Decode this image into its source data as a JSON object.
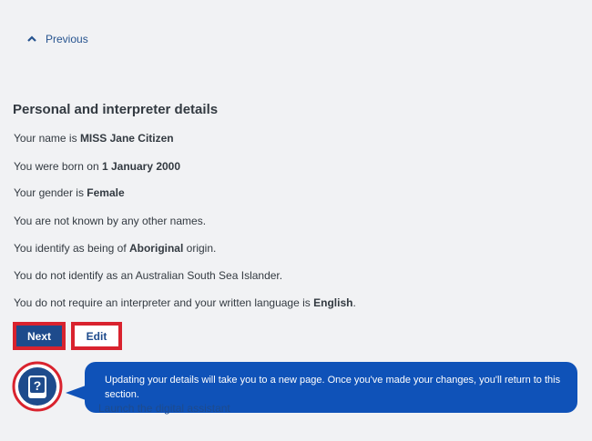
{
  "nav": {
    "previous_label": "Previous"
  },
  "section": {
    "heading": "Personal and interpreter details",
    "name": {
      "prefix": "Your name is ",
      "value": "MISS Jane Citizen"
    },
    "dob": {
      "prefix": "You were born on ",
      "value": "1 January 2000"
    },
    "gender": {
      "prefix": "Your gender is ",
      "value": "Female"
    },
    "other_names": "You are not known by any other names.",
    "origin": {
      "prefix": "You identify as being of ",
      "value": "Aboriginal",
      "suffix": " origin."
    },
    "islander": "You do not identify as an Australian South Sea Islander.",
    "language": {
      "prefix": "You do not require an interpreter and your written language is ",
      "value": "English",
      "suffix": "."
    }
  },
  "actions": {
    "next_label": "Next",
    "edit_label": "Edit"
  },
  "assistant": {
    "message": "Updating your details will take you to a new page. Once you've made your changes, you'll return to this section.",
    "launch_label": "Launch the digital assistant",
    "icon_glyph": "?"
  },
  "colors": {
    "primary": "#1e4b8c",
    "highlight": "#d9232e",
    "bubble": "#0f52b8",
    "background": "#f1f2f4"
  }
}
